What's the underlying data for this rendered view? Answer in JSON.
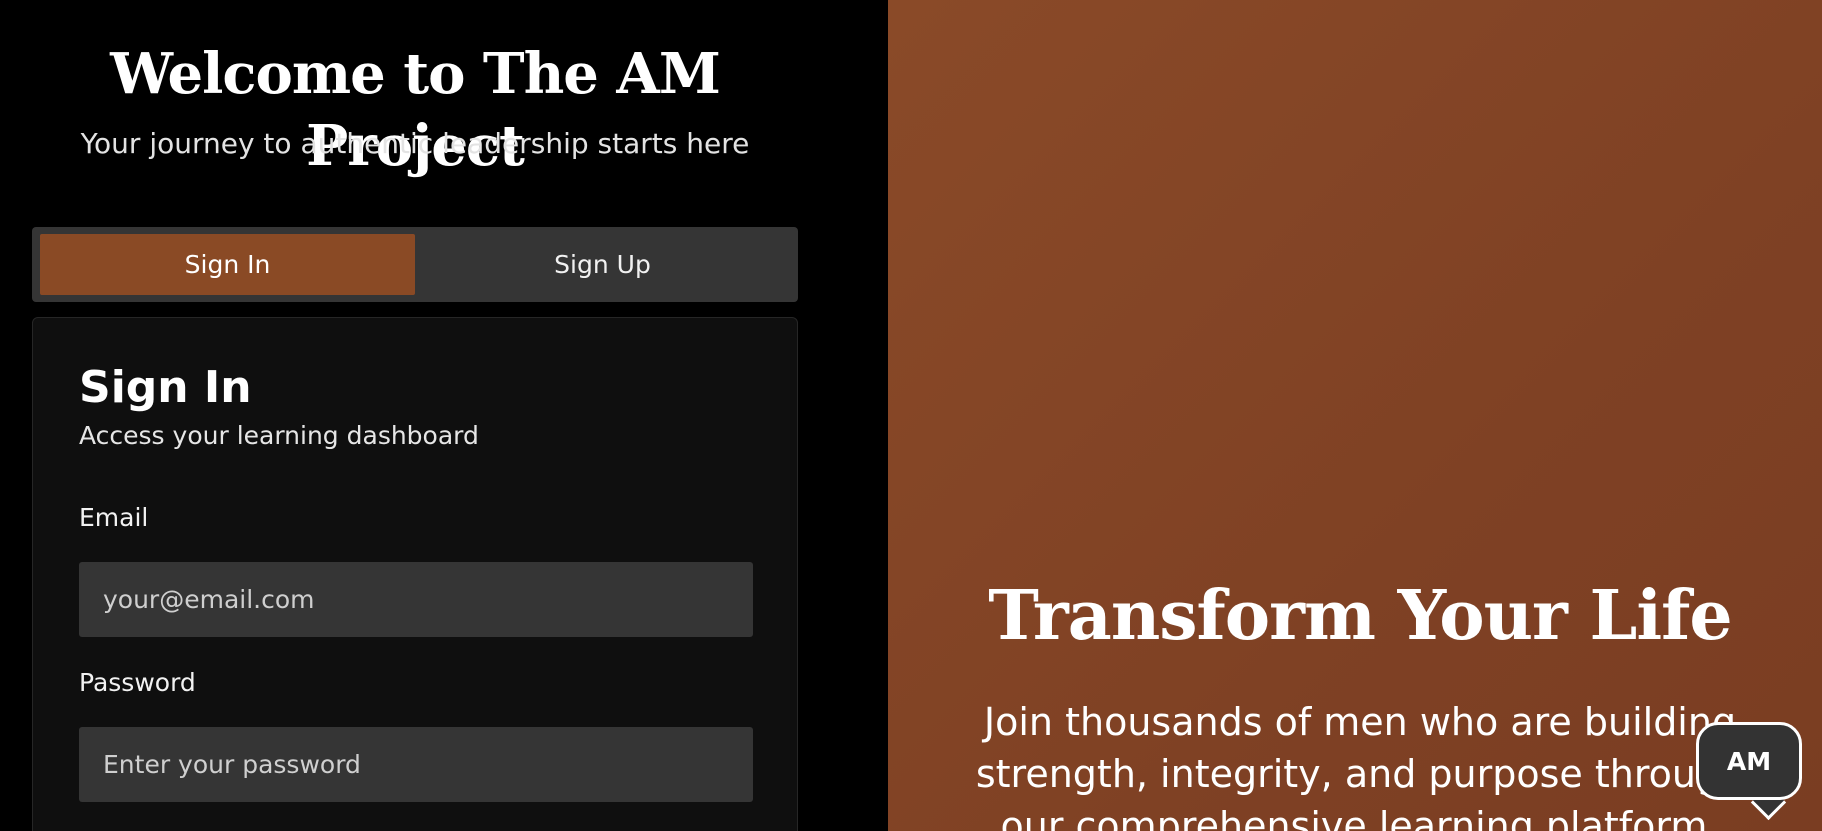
{
  "welcome": {
    "title": "Welcome to The AM Project",
    "subtitle": "Your journey to authentic leadership starts here"
  },
  "tabs": [
    {
      "label": "Sign In",
      "active": true
    },
    {
      "label": "Sign Up",
      "active": false
    }
  ],
  "signin_card": {
    "title": "Sign In",
    "subtitle": "Access your learning dashboard",
    "email_label": "Email",
    "email_placeholder": "your@email.com",
    "email_value": "",
    "password_label": "Password",
    "password_placeholder": "Enter your password",
    "password_value": ""
  },
  "hero": {
    "title": "Transform Your Life",
    "text": "Join thousands of men who are building strength, integrity, and purpose through our comprehensive learning platform."
  },
  "chat_widget": {
    "label": "AM",
    "icon": "chat-bubble-icon"
  },
  "colors": {
    "accent": "#8a4a25",
    "left_background": "#000000",
    "card_background": "#0f0f0f",
    "input_background": "#353535",
    "right_background": "#823f24"
  }
}
